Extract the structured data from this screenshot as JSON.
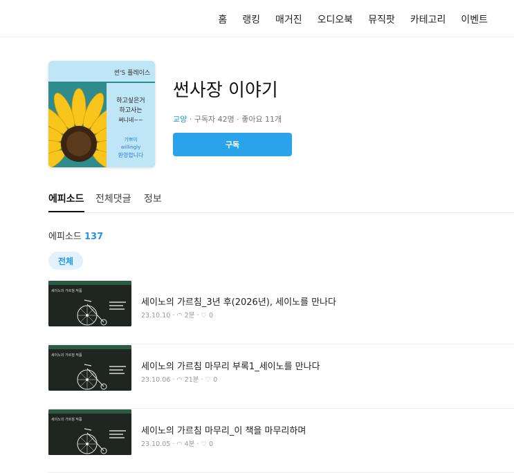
{
  "nav": {
    "items": [
      "홈",
      "랭킹",
      "매거진",
      "오디오북",
      "뮤직팟",
      "카테고리",
      "이벤트"
    ]
  },
  "cover": {
    "header_text": "썬'S 플레이스",
    "line1": "하고싶은거",
    "line2": "하고사는",
    "line3": "써니네~~",
    "line4": "기쁘이",
    "line5": "willingly",
    "line6": "환영합니다",
    "colors": {
      "top": "#bfe6f6",
      "bottom": "#2f8c8d",
      "petal": "#f7c51b"
    }
  },
  "title": "썬사장 이야기",
  "meta": {
    "genre": "교양",
    "rest": " · 구독자 42명 · 좋아요 11개"
  },
  "subscribe_label": "구독",
  "tabs": [
    "에피소드",
    "전체댓글",
    "정보"
  ],
  "episodes_label": "에피소드",
  "episodes_count": "137",
  "filter_chip": "전체",
  "episodes": [
    {
      "title": "세이노의 가르침_3년 후(2026년), 세이노를 만나다",
      "meta": "23.10.10 · ◠ 2분 · ♡ 0",
      "thumb_text": "세이노의 가르침 작품"
    },
    {
      "title": "세이노의 가르침 마무리 부록1_세이노를 만나다",
      "meta": "23.10.06 · ◠ 21분 · ♡ 0",
      "thumb_text": "세이노의 가르침 작품"
    },
    {
      "title": "세이노의 가르침 마무리_이 책을 마무리하며",
      "meta": "23.10.05 · ◠ 4분 · ♡ 0",
      "thumb_text": "세이노의 가르침 작품"
    }
  ],
  "accent_color": "#2aa3ea"
}
